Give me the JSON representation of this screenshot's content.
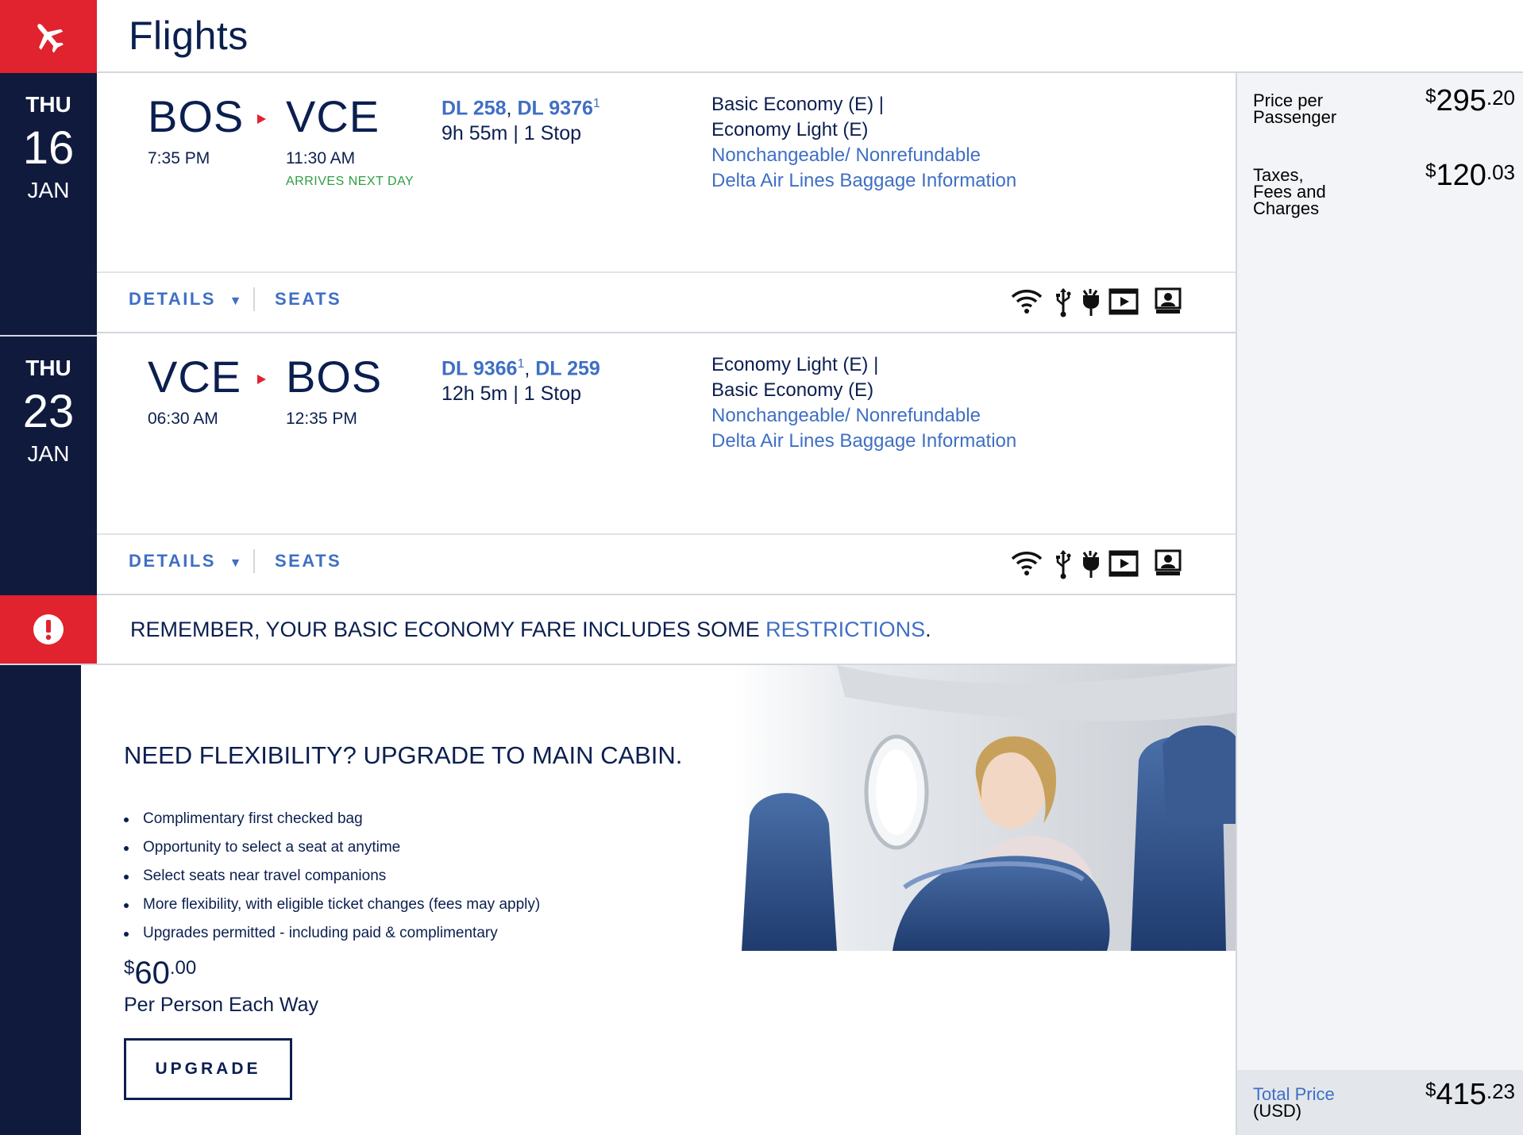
{
  "header": {
    "title": "Flights",
    "icon": "airplane-icon"
  },
  "flights": [
    {
      "date": {
        "dow": "THU",
        "day": "16",
        "month": "JAN"
      },
      "origin": {
        "code": "BOS",
        "time": "7:35 PM"
      },
      "destination": {
        "code": "VCE",
        "time": "11:30 AM",
        "note": "ARRIVES NEXT DAY"
      },
      "flight_numbers": [
        {
          "number": "DL 258",
          "sup": ""
        },
        {
          "number": "DL 9376",
          "sup": "1"
        }
      ],
      "duration": "9h 55m | 1 Stop",
      "fare_lines": [
        "Basic Economy (E) |",
        "Economy Light (E)"
      ],
      "fare_links": [
        "Nonchangeable/ Nonrefundable",
        "Delta Air Lines Baggage Information"
      ],
      "actions": {
        "details": "DETAILS",
        "seats": "SEATS"
      },
      "amenities": [
        "wifi-icon",
        "usb-icon",
        "power-icon",
        "video-icon",
        "personal-screen-icon"
      ]
    },
    {
      "date": {
        "dow": "THU",
        "day": "23",
        "month": "JAN"
      },
      "origin": {
        "code": "VCE",
        "time": "06:30 AM"
      },
      "destination": {
        "code": "BOS",
        "time": "12:35 PM",
        "note": ""
      },
      "flight_numbers": [
        {
          "number": "DL 9366",
          "sup": "1"
        },
        {
          "number": "DL 259",
          "sup": ""
        }
      ],
      "duration": "12h 5m | 1 Stop",
      "fare_lines": [
        "Economy Light (E) |",
        "Basic Economy (E)"
      ],
      "fare_links": [
        "Nonchangeable/ Nonrefundable",
        "Delta Air Lines Baggage Information"
      ],
      "actions": {
        "details": "DETAILS",
        "seats": "SEATS"
      },
      "amenities": [
        "wifi-icon",
        "usb-icon",
        "power-icon",
        "video-icon",
        "personal-screen-icon"
      ]
    }
  ],
  "alert": {
    "text": "REMEMBER, YOUR BASIC ECONOMY FARE INCLUDES SOME ",
    "link": "RESTRICTIONS",
    "end": "."
  },
  "upgrade": {
    "headline": "NEED FLEXIBILITY? UPGRADE TO MAIN CABIN.",
    "benefits": [
      "Complimentary first checked bag",
      "Opportunity to select a seat at anytime",
      "Select seats near travel companions",
      "More flexibility, with eligible ticket changes (fees may apply)",
      "Upgrades permitted - including paid & complimentary"
    ],
    "price": {
      "currency": "$",
      "whole": "60",
      "cents": ".00"
    },
    "per": "Per Person Each Way",
    "button": "UPGRADE"
  },
  "summary": {
    "price_per_passenger": {
      "label_line1": "Price per",
      "label_line2": "Passenger",
      "currency": "$",
      "whole": "295",
      "cents": ".20"
    },
    "taxes": {
      "label_line1": "Taxes,",
      "label_line2": "Fees and",
      "label_line3": "Charges",
      "currency": "$",
      "whole": "120",
      "cents": ".03"
    },
    "total": {
      "label": "Total Price",
      "sub": "(USD)",
      "currency": "$",
      "whole": "415",
      "cents": ".23"
    }
  },
  "colors": {
    "navy": "#0b1f4f",
    "sidebar_navy": "#101a3d",
    "delta_red": "#e0232e",
    "link_blue": "#3f6fc4",
    "green": "#2f9d44"
  }
}
